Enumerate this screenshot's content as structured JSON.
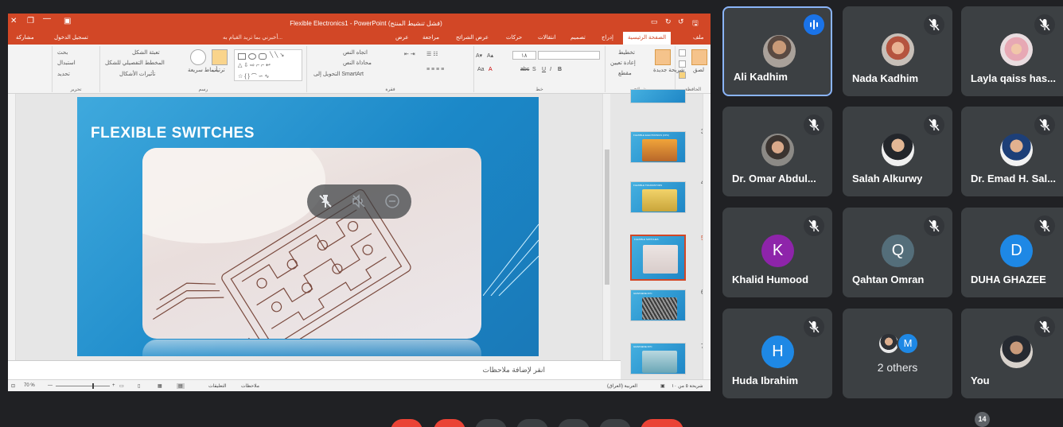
{
  "powerpoint": {
    "title": "Flexible Electronics1 - PowerPoint (فشل تنشيط المنتج)",
    "tabs": [
      "ملف",
      "الصفحة الرئيسية",
      "إدراج",
      "تصميم",
      "انتقالات",
      "حركات",
      "عرض الشرائح",
      "مراجعة",
      "عرض"
    ],
    "active_tab": "الصفحة الرئيسية",
    "tell_me": "أخبرني بما تريد القيام به...",
    "sign_in": "تسجيل الدخول",
    "share": "مشاركة",
    "ribbon": {
      "paste": "لصق",
      "new_slide": "شريحة جديدة",
      "layout": "تخطيط",
      "reset": "إعادة تعيين",
      "section": "مقطع",
      "font_size": "١٨",
      "text_direction": "اتجاه النص",
      "align_text": "محاذاة النص",
      "smartart": "التحويل إلى SmartArt",
      "arrange": "ترتيب",
      "quick_styles": "أنماط سريعة",
      "shape_fill": "تعبئة الشكل",
      "shape_outline": "المخطط التفصيلي للشكل",
      "shape_effects": "تأثيرات الأشكال",
      "find": "بحث",
      "replace": "استبدال",
      "select": "تحديد",
      "groups": {
        "clipboard": "الحافظة",
        "slides": "شرائح",
        "font": "خط",
        "paragraph": "فقرة",
        "drawing": "رسم",
        "editing": "تحرير"
      }
    },
    "slide": {
      "title": "FLEXIBLE SWITCHES"
    },
    "notes_placeholder": "انقر لإضافة ملاحظات",
    "thumbnails": [
      {
        "num": "3",
        "label": "FLEXIBLE ELECTRONICS (FPC)",
        "selected": false
      },
      {
        "num": "4",
        "label": "FLEXIBLE TRANSISTORS",
        "selected": false
      },
      {
        "num": "5",
        "label": "FLEXIBLE SWITCHES",
        "selected": true
      },
      {
        "num": "6",
        "label": "GRAPHENE FPC",
        "selected": false
      },
      {
        "num": "7",
        "label": "GRAPHENE FPC",
        "selected": false
      }
    ],
    "status": {
      "slide_info": "شريحة ٥ من ١٠",
      "language": "العربية (العراق)",
      "notes": "ملاحظات",
      "comments": "التعليقات",
      "zoom": "70 %"
    }
  },
  "participants": [
    {
      "name": "Ali Kadhim",
      "speaking": true,
      "avatar_type": "photo"
    },
    {
      "name": "Nada Kadhim",
      "speaking": false,
      "avatar_type": "photo"
    },
    {
      "name": "Layla qaiss has...",
      "speaking": false,
      "avatar_type": "photo"
    },
    {
      "name": "Dr. Omar Abdul...",
      "speaking": false,
      "avatar_type": "photo"
    },
    {
      "name": "Salah Alkurwy",
      "speaking": false,
      "avatar_type": "photo"
    },
    {
      "name": "Dr. Emad H. Sal...",
      "speaking": false,
      "avatar_type": "photo"
    },
    {
      "name": "Khalid Humood",
      "speaking": false,
      "avatar_type": "letter",
      "letter": "K",
      "color": "#8e24aa"
    },
    {
      "name": "Qahtan Omran",
      "speaking": false,
      "avatar_type": "letter",
      "letter": "Q",
      "color": "#546e7a"
    },
    {
      "name": "DUHA GHAZEE",
      "speaking": false,
      "avatar_type": "letter",
      "letter": "D",
      "color": "#1e88e5"
    },
    {
      "name": "Huda Ibrahim",
      "speaking": false,
      "avatar_type": "letter",
      "letter": "H",
      "color": "#1e88e5"
    },
    {
      "name": "2 others",
      "speaking": false,
      "avatar_type": "group",
      "letter": "M",
      "color": "#1e88e5"
    },
    {
      "name": "You",
      "speaking": false,
      "avatar_type": "photo"
    }
  ],
  "participant_count": "14",
  "colors": {
    "ppt_orange": "#d24726",
    "meet_bg": "#202124",
    "tile_bg": "#3c4043",
    "active_border": "#8ab4f8",
    "speak_blue": "#1a73e8"
  }
}
